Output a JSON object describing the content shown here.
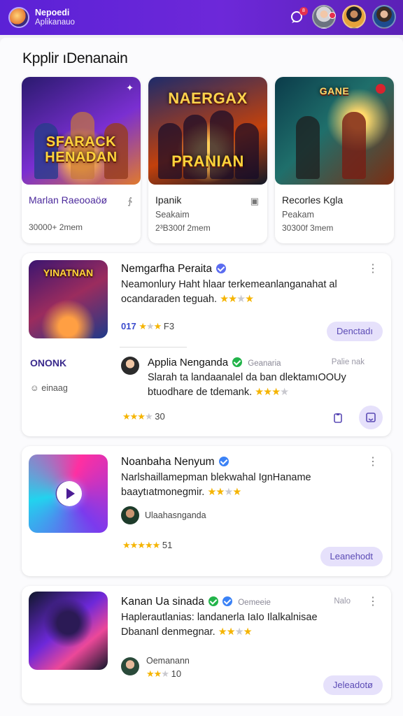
{
  "header": {
    "brand_line1": "Nepoedi",
    "brand_line2": "Aplikanauo",
    "notif_count": "8"
  },
  "section": {
    "title": "Kpplir ıDenanain"
  },
  "featured": [
    {
      "art_text_top": "SFARACK",
      "art_text_bottom": "HENADAN",
      "title": "Marlan Raeooaöø",
      "subtitle": "",
      "meta": "30000+ 2mem",
      "right": "∱"
    },
    {
      "art_text_top": "NAERGAX",
      "art_text_bottom": "PRANIAN",
      "title": "Ipanik",
      "subtitle": "Seakaim",
      "meta": "2³B300f 2mem",
      "right": "▣"
    },
    {
      "art_text_top": "GANE",
      "art_text_bottom": "",
      "title": "Recorles Kgla",
      "subtitle": "Peakam",
      "meta": "30300f 3mem",
      "right": ""
    }
  ],
  "list": [
    {
      "thumb_text": "YINATNAN",
      "title": "Nemgarfha Peraita",
      "desc1": "Neamonlury Haht hlaar terkemeanlanganahat al",
      "desc2": "ocandaraden teguah.",
      "rating_text": "017",
      "rating_value": "F3",
      "button": "Denctadı",
      "side_label": "ONONK",
      "side_meta": "einaag",
      "reply": {
        "author": "Applia Nenganda",
        "tag": "Geanaria",
        "tag_right": "Palie nak",
        "desc1": "Slarah ta landaanalel da ban dlektamıOOUy",
        "desc2": "btuodhare de tdemank.",
        "rating_value": "30"
      }
    },
    {
      "title": "Noanbaha Nenyum",
      "desc1": "Narlshaillamepman blekwahal IgnHaname",
      "desc2": "baaytıatmonegmir.",
      "author": "Ulaahasnganda",
      "rating_value": "51",
      "button": "Leanehodt"
    },
    {
      "title": "Kanan Ua sinada",
      "tag": "Oemeeie",
      "tag_right": "Nalo",
      "desc1": "Haplerautlanias: landanerla IaIo Ilalkalnisae",
      "desc2": "Dbananl denmegnar.",
      "author": "Oemanann",
      "rating_value": "10",
      "button": "Jeleadotø"
    }
  ],
  "colors": {
    "accent": "#6d28d9",
    "button_bg": "#e6e1fb",
    "star": "#f5b400"
  }
}
